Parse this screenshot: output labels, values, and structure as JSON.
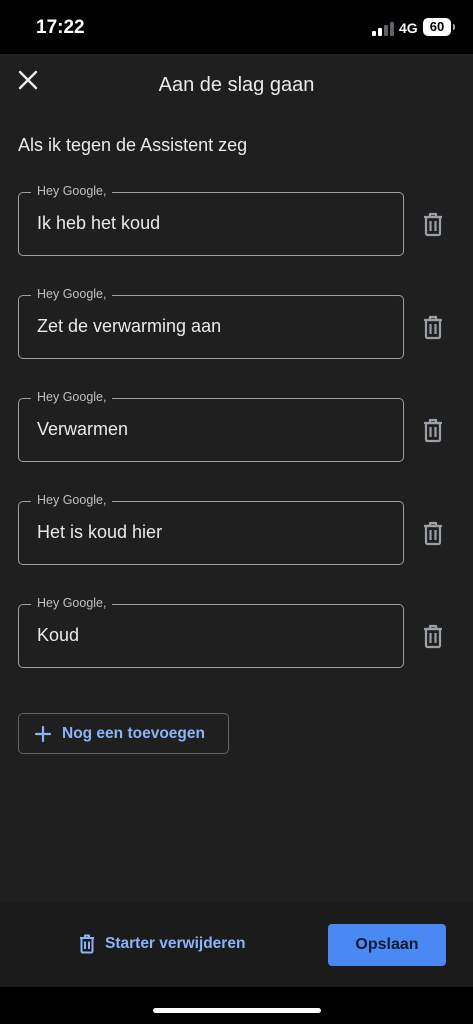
{
  "status_bar": {
    "time": "17:22",
    "network": "4G",
    "battery": "60"
  },
  "header": {
    "title": "Aan de slag gaan",
    "close_icon": "close-icon"
  },
  "section": {
    "label": "Als ik tegen de Assistent zeg"
  },
  "phrases": [
    {
      "legend": "Hey Google,",
      "value": "Ik heb het koud"
    },
    {
      "legend": "Hey Google,",
      "value": "Zet de verwarming aan"
    },
    {
      "legend": "Hey Google,",
      "value": "Verwarmen"
    },
    {
      "legend": "Hey Google,",
      "value": "Het is koud hier"
    },
    {
      "legend": "Hey Google,",
      "value": "Koud"
    }
  ],
  "add_button": {
    "label": "Nog een toevoegen",
    "icon": "plus-icon"
  },
  "footer": {
    "delete_label": "Starter verwijderen",
    "delete_icon": "trash-icon",
    "save_label": "Opslaan"
  },
  "colors": {
    "background": "#1f1f1f",
    "accent": "#8ab4f8",
    "primary_button": "#4a89f3"
  }
}
